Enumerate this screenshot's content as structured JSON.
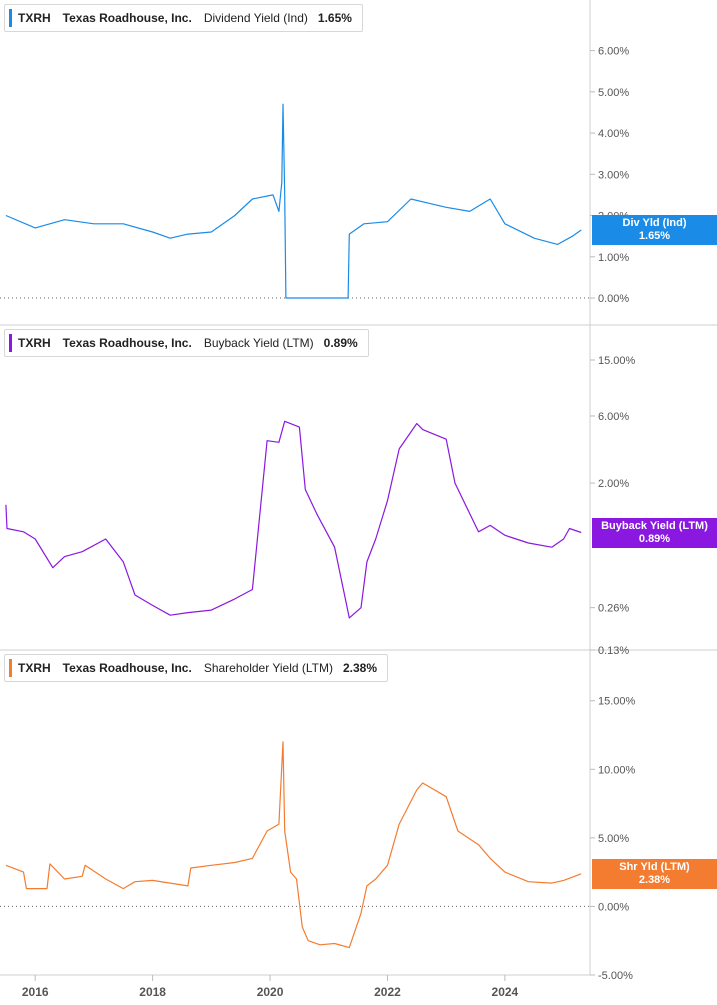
{
  "chart_data": [
    {
      "type": "line",
      "ticker": "TXRH",
      "company": "Texas Roadhouse, Inc.",
      "metric": "Dividend Yield (Ind)",
      "current_value": "1.65%",
      "badge_label": "Div Yld (Ind)",
      "badge_value": "1.65%",
      "color": "#1a8be6",
      "y_ticks": [
        "6.00%",
        "5.00%",
        "4.00%",
        "3.00%",
        "2.00%",
        "1.00%",
        "0.00%"
      ],
      "y_tick_values": [
        6,
        5,
        4,
        3,
        2,
        1,
        0
      ],
      "ylim": [
        0,
        6.5
      ],
      "y_scale": "linear",
      "dotted_zero": true,
      "series": [
        {
          "x": [
            2015.5,
            2016.0,
            2016.5,
            2017.0,
            2017.5,
            2018.0,
            2018.3,
            2018.6,
            2019.0,
            2019.4,
            2019.7,
            2020.05,
            2020.15,
            2020.2,
            2020.22,
            2020.25,
            2020.27,
            2021.33,
            2021.35,
            2021.6,
            2022.0,
            2022.4,
            2022.7,
            2023.0,
            2023.4,
            2023.75,
            2024.0,
            2024.5,
            2024.9,
            2025.15,
            2025.3
          ],
          "y": [
            2.0,
            1.7,
            1.9,
            1.8,
            1.8,
            1.6,
            1.45,
            1.55,
            1.6,
            2.0,
            2.4,
            2.5,
            2.1,
            2.8,
            4.7,
            2.5,
            0.0,
            0.0,
            1.55,
            1.8,
            1.85,
            2.4,
            2.3,
            2.2,
            2.1,
            2.4,
            1.8,
            1.45,
            1.3,
            1.5,
            1.65
          ]
        }
      ]
    },
    {
      "type": "line",
      "ticker": "TXRH",
      "company": "Texas Roadhouse, Inc.",
      "metric": "Buyback Yield (LTM)",
      "current_value": "0.89%",
      "badge_label": "Buyback Yield (LTM)",
      "badge_value": "0.89%",
      "color": "#8a18e0",
      "y_ticks": [
        "15.00%",
        "6.00%",
        "2.00%",
        "0.26%",
        "0.13%"
      ],
      "y_tick_values": [
        15,
        6,
        2,
        0.26,
        0.13
      ],
      "hidden_tick": "0.89%",
      "ylim": [
        0.13,
        15
      ],
      "y_scale": "log",
      "dotted_zero": false,
      "series": [
        {
          "x": [
            2015.5,
            2015.52,
            2015.8,
            2016.0,
            2016.3,
            2016.5,
            2016.8,
            2017.2,
            2017.5,
            2017.7,
            2018.0,
            2018.3,
            2018.6,
            2019.0,
            2019.4,
            2019.7,
            2019.95,
            2020.15,
            2020.25,
            2020.5,
            2020.6,
            2020.8,
            2021.1,
            2021.35,
            2021.55,
            2021.65,
            2021.8,
            2022.0,
            2022.2,
            2022.5,
            2022.6,
            2023.0,
            2023.15,
            2023.55,
            2023.75,
            2024.0,
            2024.4,
            2024.8,
            2025.0,
            2025.1,
            2025.3
          ],
          "y": [
            1.4,
            0.95,
            0.9,
            0.8,
            0.5,
            0.6,
            0.65,
            0.8,
            0.55,
            0.32,
            0.27,
            0.23,
            0.24,
            0.25,
            0.3,
            0.35,
            4.0,
            3.9,
            5.5,
            5.0,
            1.8,
            1.2,
            0.7,
            0.22,
            0.26,
            0.55,
            0.8,
            1.5,
            3.5,
            5.3,
            4.8,
            4.1,
            2.0,
            0.9,
            1.0,
            0.85,
            0.75,
            0.7,
            0.8,
            0.95,
            0.89
          ]
        }
      ]
    },
    {
      "type": "line",
      "ticker": "TXRH",
      "company": "Texas Roadhouse, Inc.",
      "metric": "Shareholder Yield (LTM)",
      "current_value": "2.38%",
      "badge_label": "Shr Yld (LTM)",
      "badge_value": "2.38%",
      "color": "#f47c30",
      "y_ticks": [
        "15.00%",
        "10.00%",
        "5.00%",
        "0.00%",
        "-5.00%"
      ],
      "y_tick_values": [
        15,
        10,
        5,
        0,
        -5
      ],
      "ylim": [
        -5,
        16
      ],
      "y_scale": "linear",
      "dotted_zero": true,
      "series": [
        {
          "x": [
            2015.5,
            2015.8,
            2015.85,
            2016.2,
            2016.25,
            2016.5,
            2016.8,
            2016.85,
            2017.2,
            2017.5,
            2017.7,
            2018.0,
            2018.3,
            2018.6,
            2018.65,
            2019.0,
            2019.4,
            2019.7,
            2019.95,
            2020.15,
            2020.22,
            2020.25,
            2020.35,
            2020.45,
            2020.55,
            2020.65,
            2020.85,
            2021.1,
            2021.35,
            2021.55,
            2021.65,
            2021.8,
            2022.0,
            2022.2,
            2022.5,
            2022.6,
            2023.0,
            2023.2,
            2023.55,
            2023.75,
            2024.0,
            2024.4,
            2024.8,
            2025.0,
            2025.3
          ],
          "y": [
            3.0,
            2.5,
            1.3,
            1.3,
            3.1,
            2.0,
            2.2,
            3.0,
            2.0,
            1.3,
            1.8,
            1.9,
            1.7,
            1.5,
            2.8,
            3.0,
            3.2,
            3.5,
            5.5,
            6.0,
            12.0,
            5.5,
            2.5,
            2.0,
            -1.5,
            -2.5,
            -2.8,
            -2.7,
            -3.0,
            -0.5,
            1.5,
            2.0,
            3.0,
            6.0,
            8.5,
            9.0,
            8.0,
            5.5,
            4.5,
            3.5,
            2.5,
            1.8,
            1.7,
            1.9,
            2.38
          ]
        }
      ]
    }
  ],
  "x_axis": {
    "tick_labels": [
      "2016",
      "2018",
      "2020",
      "2022",
      "2024"
    ],
    "tick_values": [
      2016,
      2018,
      2020,
      2022,
      2024
    ],
    "range": [
      2015.4,
      2025.45
    ]
  }
}
